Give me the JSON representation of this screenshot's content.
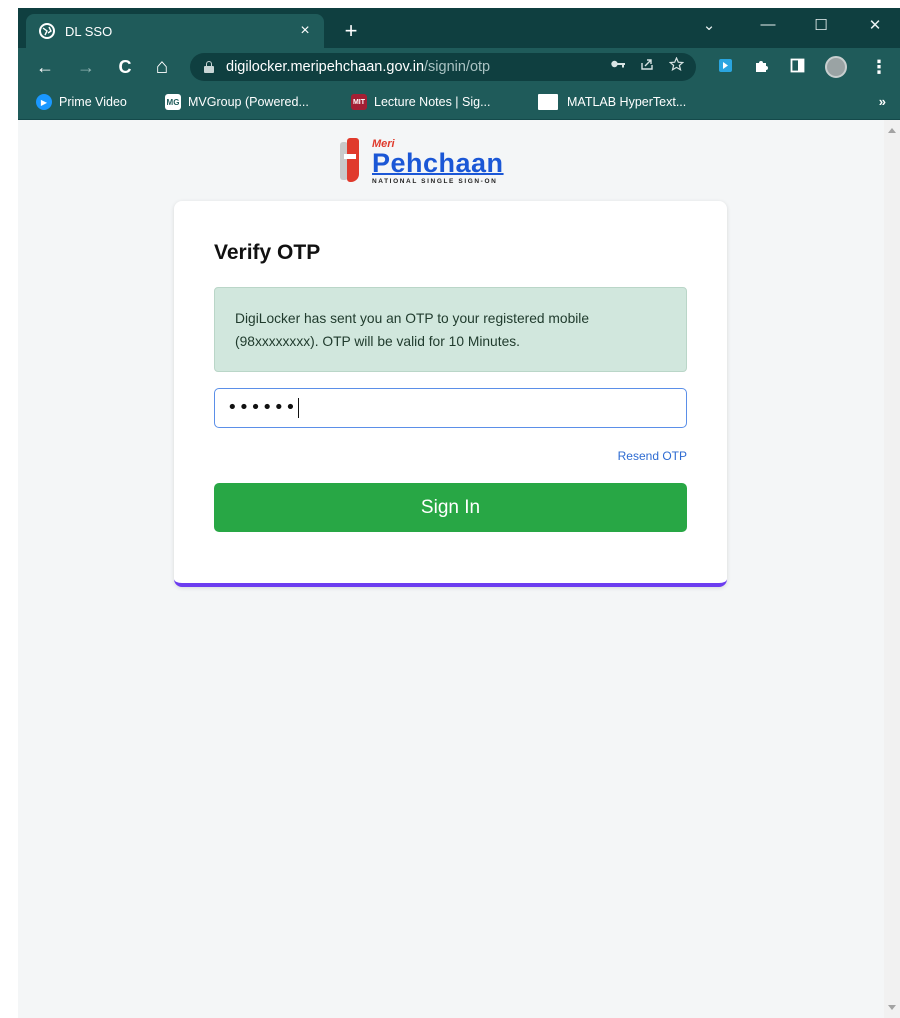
{
  "browser": {
    "tab_title": "DL SSO",
    "tab_close": "×",
    "new_tab": "+",
    "window_controls": {
      "menu": "⌄",
      "minimize": "—",
      "maximize": "☐",
      "close": "✕"
    },
    "url_host": "digilocker.meripehchaan.gov.in",
    "url_path": "/signin/otp",
    "nav": {
      "back": "←",
      "forward": "→",
      "reload": "C",
      "home": "⌂"
    },
    "omnibox_icons": [
      "key-icon",
      "share-icon",
      "star-icon"
    ],
    "extensions": [
      "screenshot-extension-icon",
      "puzzle-icon",
      "sidepanel-icon"
    ],
    "menu": "⋮",
    "bookmarks": [
      {
        "label": "Prime Video",
        "icon": "prime-video-icon",
        "icon_text": "▶",
        "color": "#1a98ff"
      },
      {
        "label": "MVGroup (Powered...",
        "icon": "mvgroup-icon",
        "icon_text": "MG",
        "color": "#ffffff"
      },
      {
        "label": "Lecture Notes | Sig...",
        "icon": "mit-ocw-icon",
        "icon_text": "MIT",
        "color": "#a31f34"
      },
      {
        "label": "MATLAB HyperText...",
        "icon": "matlab-icon",
        "icon_text": "",
        "color": "#ffffff"
      }
    ],
    "bookmarks_more": "»"
  },
  "logo": {
    "meri": "Meri",
    "name": "Pehchaan",
    "subtitle": "NATIONAL SINGLE SIGN-ON"
  },
  "card": {
    "title": "Verify OTP",
    "alert_text": "DigiLocker has sent you an OTP to your registered mobile (98xxxxxxxx). OTP will be valid for 10 Minutes.",
    "otp_value": "••••••",
    "resend_label": "Resend OTP",
    "signin_label": "Sign In"
  },
  "colors": {
    "chrome_dark": "#0f3f40",
    "chrome_mid": "#1f5b5a",
    "alert_bg": "#d1e7dd",
    "signin_green": "#28a745",
    "card_accent": "#6c3df0",
    "logo_red": "#e03a2c",
    "logo_blue": "#1b57d6"
  }
}
